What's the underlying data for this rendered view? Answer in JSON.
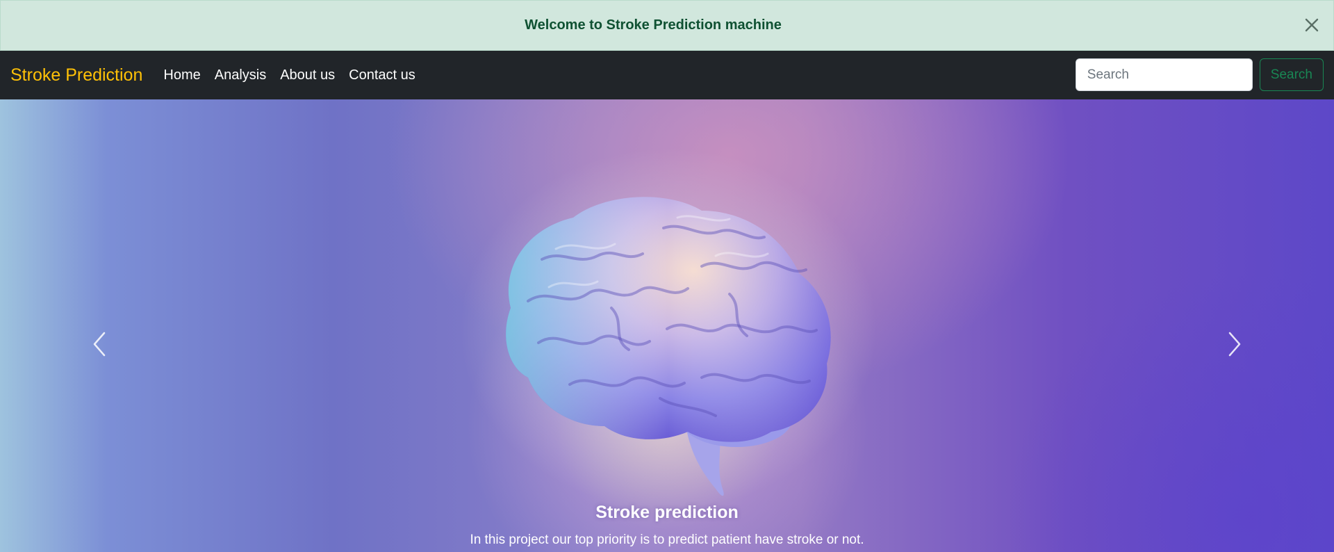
{
  "alert": {
    "message": "Welcome to Stroke Prediction machine",
    "close_icon": "close-icon"
  },
  "navbar": {
    "brand": "Stroke Prediction",
    "brand_color": "#ffc107",
    "links": [
      "Home",
      "Analysis",
      "About us",
      "Contact us"
    ],
    "search": {
      "placeholder": "Search",
      "button_label": "Search",
      "button_color": "#198754"
    }
  },
  "carousel": {
    "image": "brain-image",
    "prev_icon": "chevron-left-icon",
    "next_icon": "chevron-right-icon",
    "caption": {
      "title": "Stroke prediction",
      "text": "In this project our top priority is to predict patient have stroke or not."
    }
  }
}
